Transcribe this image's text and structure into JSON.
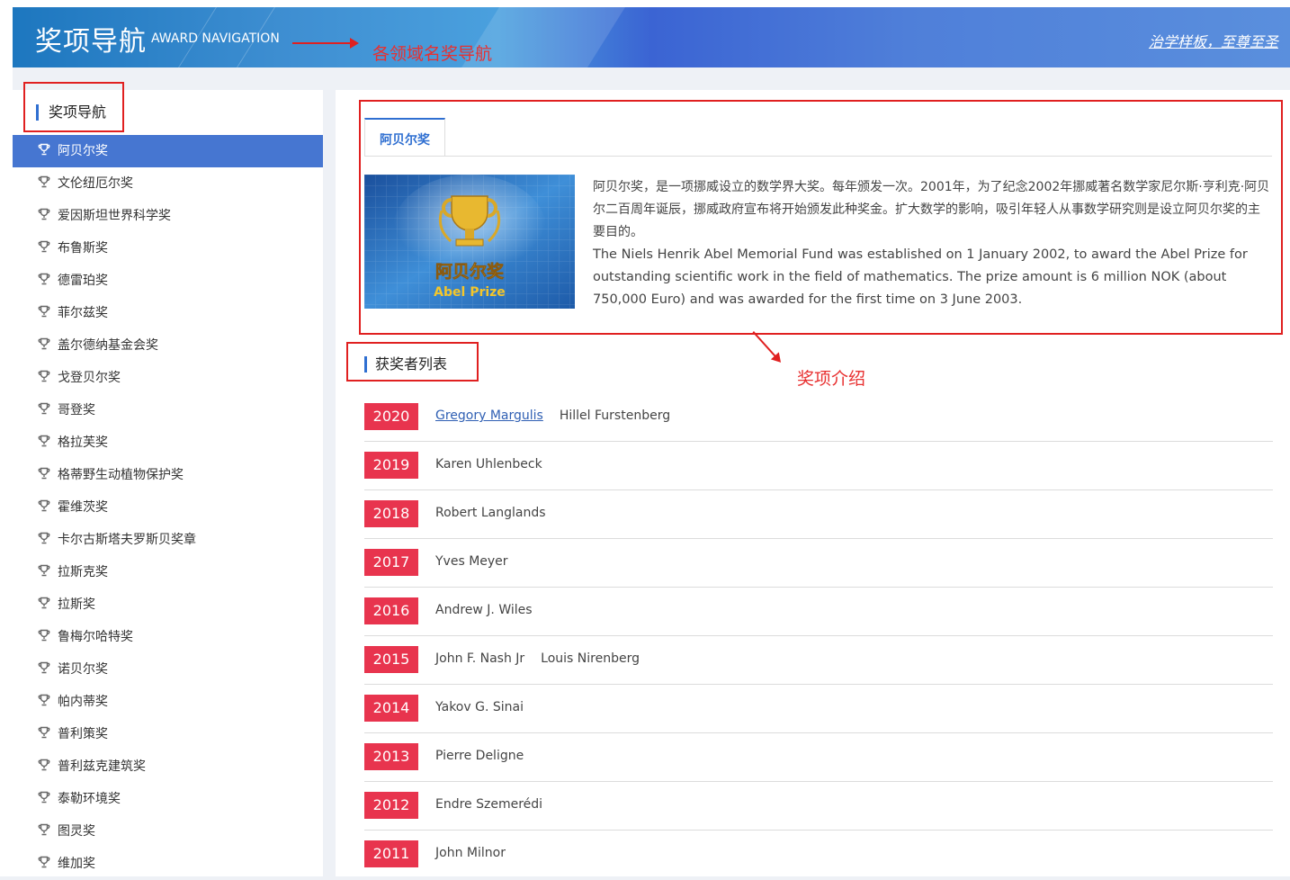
{
  "header": {
    "title": "奖项导航",
    "subtitle": "AWARD NAVIGATION",
    "motto": "治学样板，至尊至圣"
  },
  "annotations": {
    "nav_note": "各领域名奖导航",
    "intro_note": "奖项介绍"
  },
  "sidebar": {
    "heading": "奖项导航",
    "items": [
      {
        "label": "阿贝尔奖",
        "active": true
      },
      {
        "label": "文伦纽厄尔奖"
      },
      {
        "label": "爱因斯坦世界科学奖"
      },
      {
        "label": "布鲁斯奖"
      },
      {
        "label": "德雷珀奖"
      },
      {
        "label": "菲尔兹奖"
      },
      {
        "label": "盖尔德纳基金会奖"
      },
      {
        "label": "戈登贝尔奖"
      },
      {
        "label": "哥登奖"
      },
      {
        "label": "格拉芙奖"
      },
      {
        "label": "格蒂野生动植物保护奖"
      },
      {
        "label": "霍维茨奖"
      },
      {
        "label": "卡尔古斯塔夫罗斯贝奖章"
      },
      {
        "label": "拉斯克奖"
      },
      {
        "label": "拉斯奖"
      },
      {
        "label": "鲁梅尔哈特奖"
      },
      {
        "label": "诺贝尔奖"
      },
      {
        "label": "帕内蒂奖"
      },
      {
        "label": "普利策奖"
      },
      {
        "label": "普利兹克建筑奖"
      },
      {
        "label": "泰勒环境奖"
      },
      {
        "label": "图灵奖"
      },
      {
        "label": "维加奖"
      }
    ],
    "icon": "trophy-icon"
  },
  "main": {
    "tab_label": "阿贝尔奖",
    "image": {
      "title_cn": "阿贝尔奖",
      "title_en": "Abel Prize",
      "icon": "trophy-icon"
    },
    "description_cn": "阿贝尔奖，是一项挪威设立的数学界大奖。每年颁发一次。2001年，为了纪念2002年挪威著名数学家尼尔斯·亨利克·阿贝尔二百周年诞辰，挪威政府宣布将开始颁发此种奖金。扩大数学的影响，吸引年轻人从事数学研究则是设立阿贝尔奖的主要目的。",
    "description_en": "The Niels Henrik Abel Memorial Fund was established on 1 January 2002, to award the Abel Prize for outstanding scientific work in the field of mathematics. The prize amount is 6 million NOK (about 750,000 Euro) and was awarded for the first time on 3 June 2003.",
    "winners_heading": "获奖者列表",
    "winners": [
      {
        "year": "2020",
        "names": [
          "Gregory Margulis",
          "Hillel Furstenberg"
        ],
        "linked": [
          true,
          false
        ]
      },
      {
        "year": "2019",
        "names": [
          "Karen Uhlenbeck"
        ]
      },
      {
        "year": "2018",
        "names": [
          "Robert Langlands"
        ]
      },
      {
        "year": "2017",
        "names": [
          "Yves Meyer"
        ]
      },
      {
        "year": "2016",
        "names": [
          "Andrew J. Wiles"
        ]
      },
      {
        "year": "2015",
        "names": [
          "John F. Nash Jr",
          "Louis Nirenberg"
        ]
      },
      {
        "year": "2014",
        "names": [
          "Yakov G. Sinai"
        ]
      },
      {
        "year": "2013",
        "names": [
          "Pierre Deligne"
        ]
      },
      {
        "year": "2012",
        "names": [
          "Endre Szemerédi"
        ]
      },
      {
        "year": "2011",
        "names": [
          "John Milnor"
        ]
      }
    ]
  },
  "colors": {
    "accent": "#2f6fd1",
    "active_nav": "#4676d1",
    "year_badge": "#e8344e",
    "annotation": "#e02020"
  }
}
